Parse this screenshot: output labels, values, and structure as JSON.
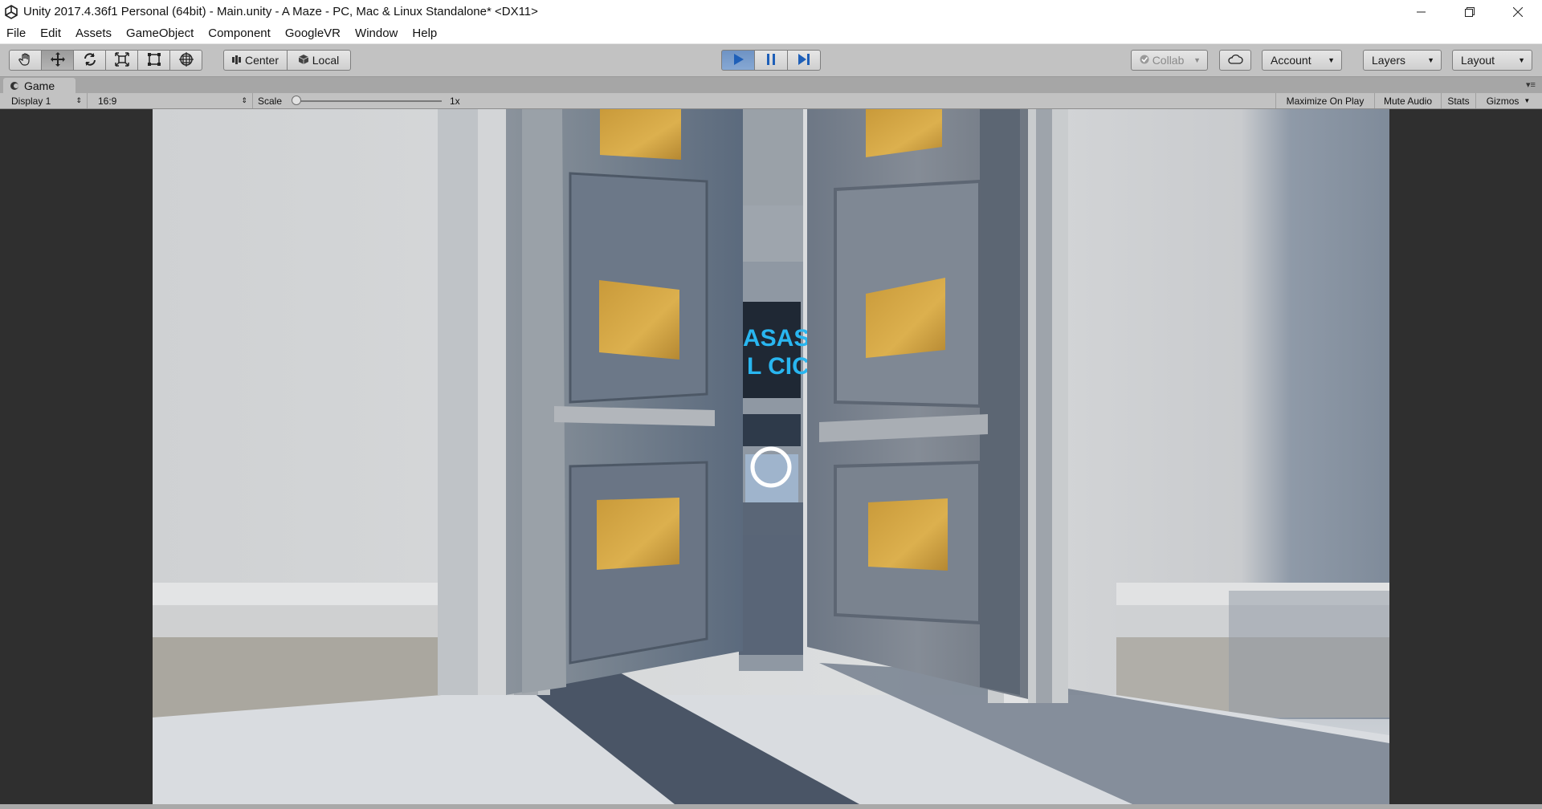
{
  "window": {
    "title": "Unity 2017.4.36f1 Personal (64bit) - Main.unity - A Maze - PC, Mac & Linux Standalone* <DX11>",
    "controls": [
      "minimize-icon",
      "restore-icon",
      "close-icon"
    ]
  },
  "menu": {
    "items": [
      "File",
      "Edit",
      "Assets",
      "GameObject",
      "Component",
      "GoogleVR",
      "Window",
      "Help"
    ]
  },
  "toolbar": {
    "tools": [
      "hand-icon",
      "move-icon",
      "rotate-icon",
      "scale-icon",
      "rect-icon",
      "transform-icon"
    ],
    "active_tool": "move-icon",
    "pivot_label": "Center",
    "space_label": "Local",
    "play_state": "playing",
    "collab_label": "Collab",
    "account_label": "Account",
    "layers_label": "Layers",
    "layout_label": "Layout"
  },
  "game_panel": {
    "tab_label": "Game",
    "display_label": "Display 1",
    "aspect_label": "16:9",
    "scale_label": "Scale",
    "scale_value": "1x",
    "maximize_label": "Maximize On Play",
    "mute_label": "Mute Audio",
    "stats_label": "Stats",
    "gizmos_label": "Gizmos"
  },
  "scene": {
    "sign_line1": "ASAST",
    "sign_line2": "L CICL",
    "sign_color": "#29b6f0",
    "reticle": "gaze-reticle"
  },
  "colors": {
    "play_active": "#6e93c4",
    "editor_bg": "#c2c2c2",
    "gold_panel": "#d6a640"
  }
}
